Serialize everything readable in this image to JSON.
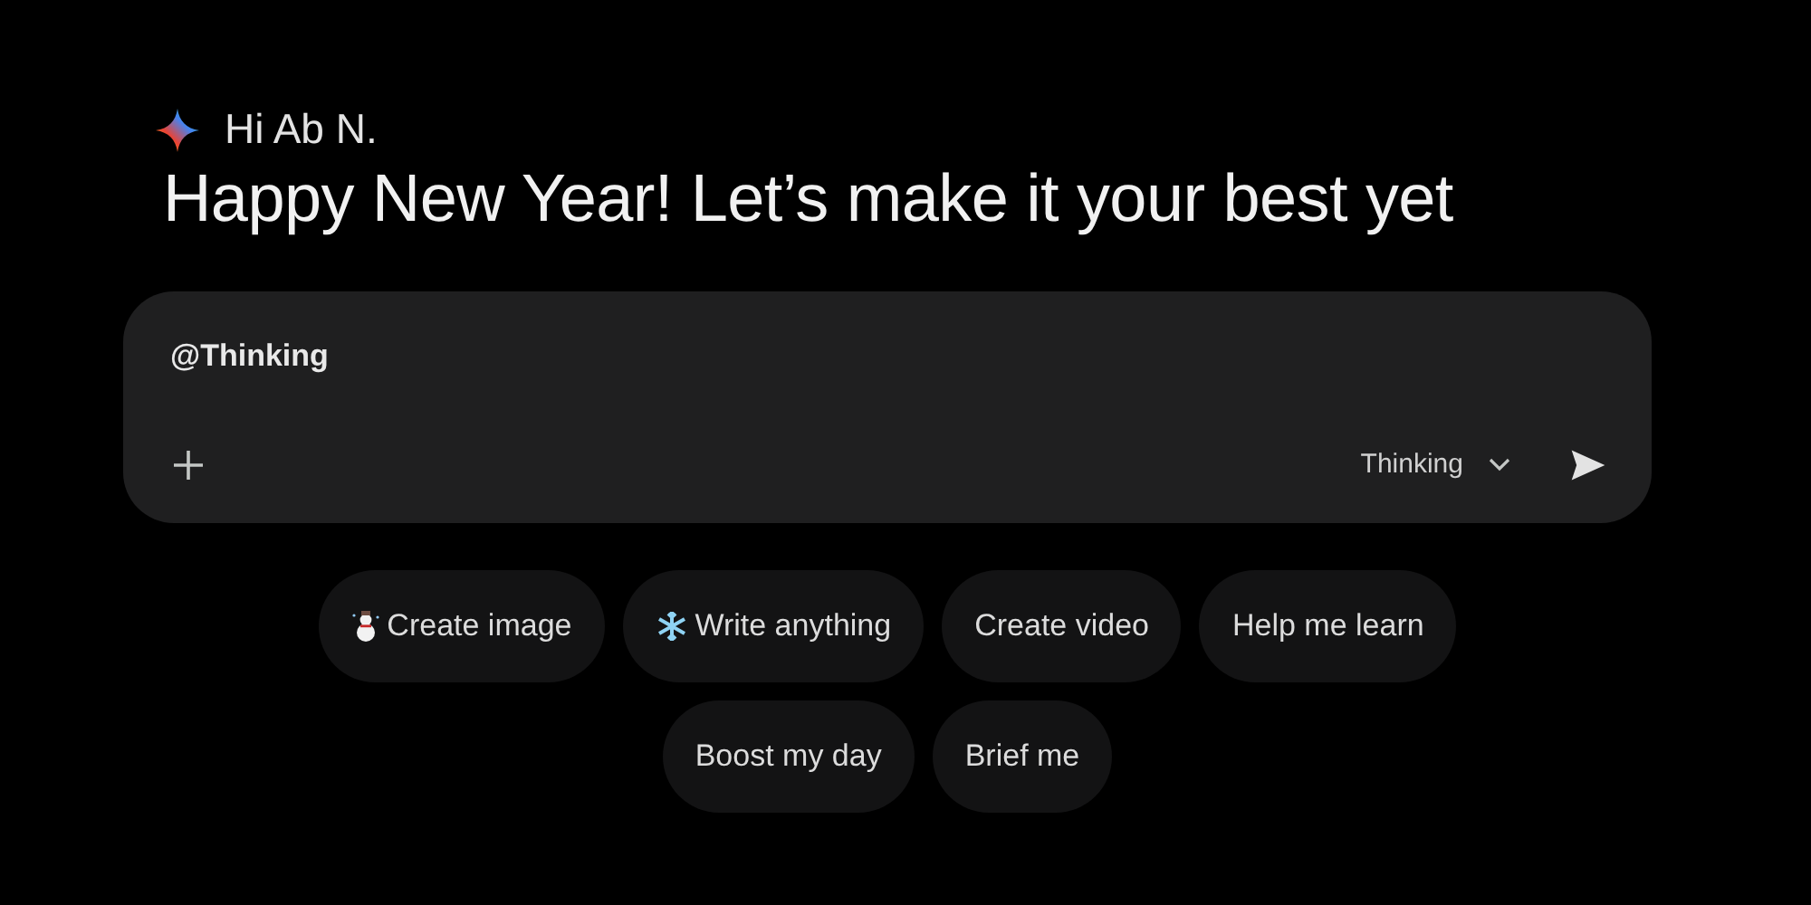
{
  "greeting": "Hi Ab N.",
  "headline": "Happy New Year! Let’s make it your best yet",
  "prompt": {
    "value": "@Thinking",
    "mode": "Thinking"
  },
  "chips": [
    {
      "label": "Create image",
      "kind": "snowman"
    },
    {
      "label": "Write anything",
      "kind": "snowflake"
    },
    {
      "label": "Create video",
      "kind": "plain"
    },
    {
      "label": "Help me learn",
      "kind": "plain"
    },
    {
      "label": "Boost my day",
      "kind": "plain"
    },
    {
      "label": "Brief me",
      "kind": "plain"
    }
  ]
}
